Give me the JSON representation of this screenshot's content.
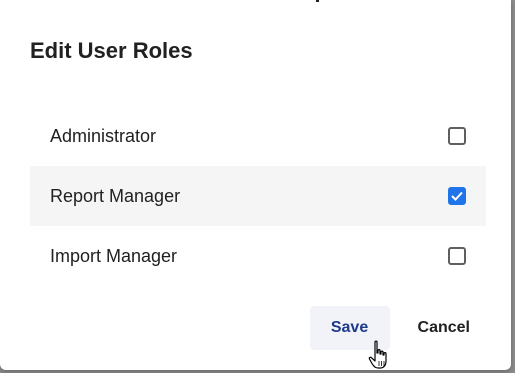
{
  "dialog": {
    "title": "Edit User Roles",
    "roles": [
      {
        "label": "Administrator",
        "checked": false
      },
      {
        "label": "Report Manager",
        "checked": true
      },
      {
        "label": "Import Manager",
        "checked": false
      }
    ],
    "save_label": "Save",
    "cancel_label": "Cancel"
  },
  "colors": {
    "accent": "#1e74e8",
    "save_text": "#1e3a8a",
    "selected_row": "#f5f5f5"
  },
  "icons": {
    "checkmark": "check-icon",
    "cursor": "hand-pointer-icon"
  }
}
